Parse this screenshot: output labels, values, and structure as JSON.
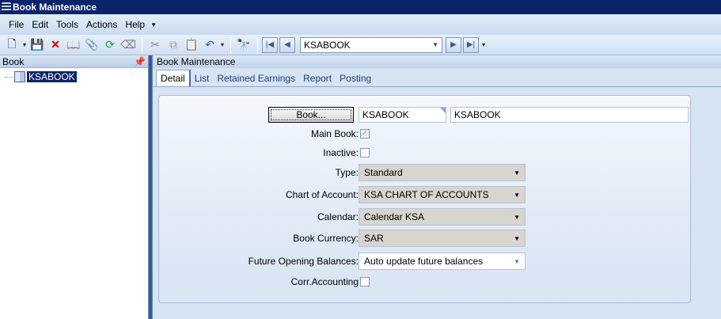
{
  "window": {
    "title": "Book Maintenance"
  },
  "menu": [
    "File",
    "Edit",
    "Tools",
    "Actions",
    "Help"
  ],
  "toolbar": {
    "record_value": "KSABOOK"
  },
  "left_pane": {
    "header": "Book",
    "tree_items": [
      "KSABOOK"
    ]
  },
  "right_pane": {
    "title": "Book Maintenance",
    "tabs": [
      "Detail",
      "List",
      "Retained Earnings",
      "Report",
      "Posting"
    ],
    "form": {
      "book_button": "Book...",
      "book_id": "KSABOOK",
      "book_description": "KSABOOK",
      "main_book_label": "Main Book:",
      "inactive_label": "Inactive:",
      "type_label": "Type:",
      "type_value": "Standard",
      "coa_label": "Chart of Account:",
      "coa_value": "KSA CHART OF ACCOUNTS",
      "calendar_label": "Calendar:",
      "calendar_value": "Calendar KSA",
      "currency_label": "Book Currency:",
      "currency_value": "SAR",
      "future_label": "Future Opening Balances:",
      "future_value": "Auto update future balances",
      "corr_label": "Corr.Accounting"
    }
  }
}
